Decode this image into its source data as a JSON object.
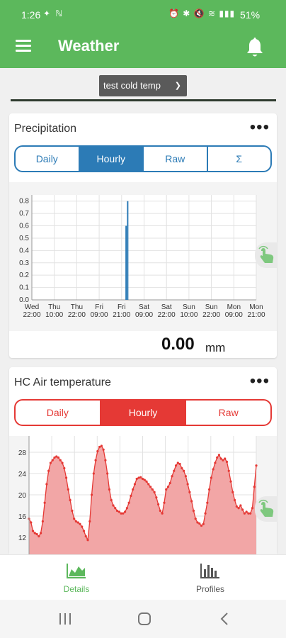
{
  "status": {
    "time": "1:26",
    "battery": "51%"
  },
  "app": {
    "title": "Weather"
  },
  "profile": {
    "selected": "test cold temp"
  },
  "precipitation": {
    "title": "Precipitation",
    "tabs": [
      "Daily",
      "Hourly",
      "Raw",
      "Σ"
    ],
    "active_tab": "Hourly",
    "reading": "0.00",
    "unit": "mm",
    "chart_data": {
      "type": "bar",
      "y_ticks": [
        "0.8",
        "0.7",
        "0.6",
        "0.5",
        "0.4",
        "0.3",
        "0.2",
        "0.1",
        "0.0"
      ],
      "ylim": [
        0,
        0.85
      ],
      "x_ticks": [
        {
          "day": "Wed",
          "time": "22:00"
        },
        {
          "day": "Thu",
          "time": "10:00"
        },
        {
          "day": "Thu",
          "time": "22:00"
        },
        {
          "day": "Fri",
          "time": "09:00"
        },
        {
          "day": "Fri",
          "time": "21:00"
        },
        {
          "day": "Sat",
          "time": "09:00"
        },
        {
          "day": "Sat",
          "time": "22:00"
        },
        {
          "day": "Sun",
          "time": "10:00"
        },
        {
          "day": "Sun",
          "time": "22:00"
        },
        {
          "day": "Mon",
          "time": "09:00"
        },
        {
          "day": "Mon",
          "time": "21:00"
        }
      ],
      "bars": [
        {
          "pos": 4.2,
          "value": 0.6
        },
        {
          "pos": 4.27,
          "value": 0.8
        }
      ],
      "color": "#2c7bb6"
    }
  },
  "air_temp": {
    "title": "HC Air temperature",
    "tabs": [
      "Daily",
      "Hourly",
      "Raw"
    ],
    "active_tab": "Hourly",
    "chart_data": {
      "type": "area",
      "y_ticks": [
        "28",
        "24",
        "20",
        "16",
        "12"
      ],
      "ylim": [
        10,
        30
      ],
      "values": [
        15.5,
        14.8,
        13.2,
        12.8,
        12.6,
        12.2,
        12.8,
        15,
        18.5,
        22,
        24.5,
        26,
        26.5,
        27,
        27.2,
        27,
        26.5,
        26,
        25,
        23.2,
        21,
        19,
        17,
        15.5,
        15,
        14.8,
        14.5,
        14,
        13.2,
        12.2,
        11.5,
        15,
        20,
        24,
        26.5,
        28.2,
        29,
        29.2,
        28.5,
        26.5,
        24,
        21,
        19,
        18,
        17.5,
        17,
        16.8,
        16.5,
        16.5,
        16.8,
        17.5,
        18.5,
        19.8,
        21,
        22,
        23,
        23.2,
        23.3,
        23,
        22.8,
        22.5,
        22,
        21.5,
        21,
        20.5,
        19.5,
        18.2,
        17,
        16.5,
        18.5,
        21,
        21.5,
        22.2,
        23.5,
        24.5,
        25.5,
        26,
        25.8,
        25,
        24.5,
        23.5,
        22,
        20.5,
        18.8,
        17,
        15.5,
        14.8,
        14.6,
        14.2,
        14.5,
        16.5,
        18.5,
        21,
        23.2,
        24.8,
        26,
        27,
        27.5,
        26.8,
        26.5,
        26.8,
        26.2,
        24.5,
        22.5,
        20.5,
        19,
        17.8,
        17.5,
        18,
        17.2,
        16.5,
        16.8,
        16.5,
        16.5,
        17.5,
        21.5,
        25.5
      ],
      "color": "#e53935"
    }
  },
  "nav": {
    "details_label": "Details",
    "profiles_label": "Profiles"
  }
}
